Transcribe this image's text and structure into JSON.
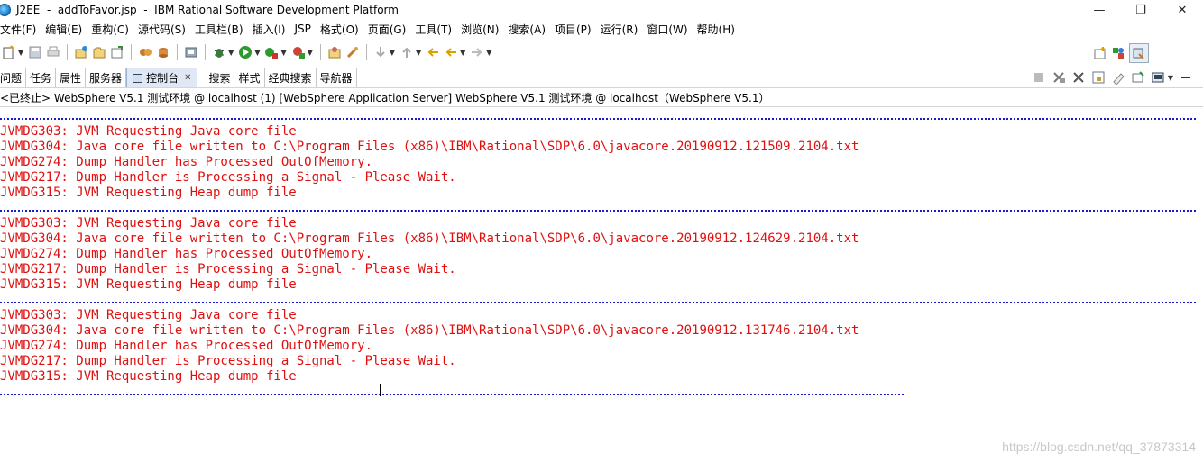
{
  "window": {
    "title": "J2EE  -  addToFavor.jsp  -  IBM Rational Software Development Platform",
    "minimize_label": "—",
    "restore_label": "❐",
    "close_label": "✕"
  },
  "menu": [
    "文件(F)",
    "编辑(E)",
    "重构(C)",
    "源代码(S)",
    "工具栏(B)",
    "插入(I)",
    "JSP",
    "格式(O)",
    "页面(G)",
    "工具(T)",
    "浏览(N)",
    "搜索(A)",
    "项目(P)",
    "运行(R)",
    "窗口(W)",
    "帮助(H)"
  ],
  "view_tabs": [
    {
      "label": "问题",
      "active": false
    },
    {
      "label": "任务",
      "active": false
    },
    {
      "label": "属性",
      "active": false
    },
    {
      "label": "服务器",
      "active": false
    },
    {
      "label": "控制台",
      "active": true
    },
    {
      "label": "搜索",
      "active": false
    },
    {
      "label": "样式",
      "active": false
    },
    {
      "label": "经典搜索",
      "active": false
    },
    {
      "label": "导航器",
      "active": false
    }
  ],
  "console": {
    "header": "<已终止> WebSphere V5.1 测试环境 @ localhost (1) [WebSphere Application Server] WebSphere V5.1 测试环境 @ localhost（WebSphere V5.1）",
    "blocks": [
      [
        "JVMDG303: JVM Requesting Java core file",
        "JVMDG304: Java core file written to C:\\Program Files (x86)\\IBM\\Rational\\SDP\\6.0\\javacore.20190912.121509.2104.txt",
        "JVMDG274: Dump Handler has Processed OutOfMemory.",
        "JVMDG217: Dump Handler is Processing a Signal - Please Wait.",
        "JVMDG315: JVM Requesting Heap dump file"
      ],
      [
        "JVMDG303: JVM Requesting Java core file",
        "JVMDG304: Java core file written to C:\\Program Files (x86)\\IBM\\Rational\\SDP\\6.0\\javacore.20190912.124629.2104.txt",
        "JVMDG274: Dump Handler has Processed OutOfMemory.",
        "JVMDG217: Dump Handler is Processing a Signal - Please Wait.",
        "JVMDG315: JVM Requesting Heap dump file"
      ],
      [
        "JVMDG303: JVM Requesting Java core file",
        "JVMDG304: Java core file written to C:\\Program Files (x86)\\IBM\\Rational\\SDP\\6.0\\javacore.20190912.131746.2104.txt",
        "JVMDG274: Dump Handler has Processed OutOfMemory.",
        "JVMDG217: Dump Handler is Processing a Signal - Please Wait.",
        "JVMDG315: JVM Requesting Heap dump file"
      ]
    ]
  },
  "watermark": "https://blog.csdn.net/qq_37873314",
  "colors": {
    "error_text": "#e01010",
    "separator_dots": "#1a1acc",
    "active_tab_bg": "#dfe8f4"
  }
}
